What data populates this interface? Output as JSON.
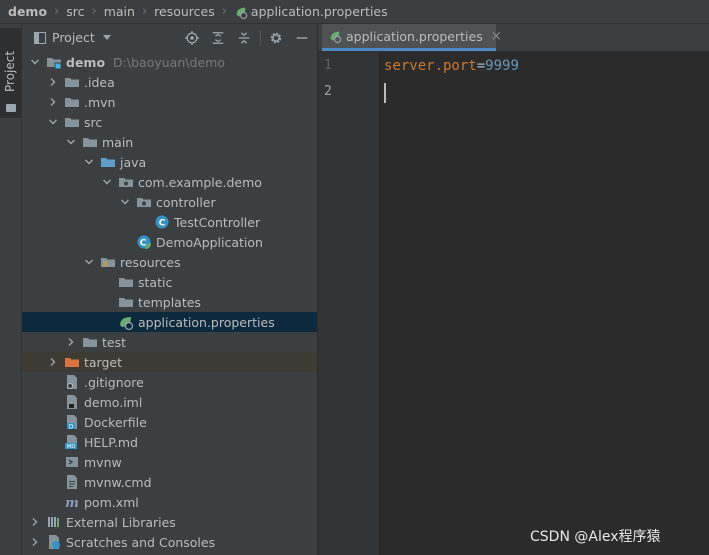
{
  "breadcrumb": [
    "demo",
    "src",
    "main",
    "resources",
    "application.properties"
  ],
  "sidebar_strip": {
    "project_tab": "Project"
  },
  "panel": {
    "title": "Project",
    "tree": [
      {
        "label": "demo",
        "path": "D:\\baoyuan\\demo",
        "icon": "module-folder-icon",
        "depth": 0,
        "arrow": "down",
        "bold": true
      },
      {
        "label": ".idea",
        "icon": "folder-icon",
        "depth": 1,
        "arrow": "right"
      },
      {
        "label": ".mvn",
        "icon": "folder-icon",
        "depth": 1,
        "arrow": "right"
      },
      {
        "label": "src",
        "icon": "folder-icon",
        "depth": 1,
        "arrow": "down"
      },
      {
        "label": "main",
        "icon": "folder-icon",
        "depth": 2,
        "arrow": "down"
      },
      {
        "label": "java",
        "icon": "source-folder-icon",
        "depth": 3,
        "arrow": "down"
      },
      {
        "label": "com.example.demo",
        "icon": "package-icon",
        "depth": 4,
        "arrow": "down"
      },
      {
        "label": "controller",
        "icon": "package-icon",
        "depth": 5,
        "arrow": "down"
      },
      {
        "label": "TestController",
        "icon": "class-icon",
        "depth": 6,
        "arrow": "none"
      },
      {
        "label": "DemoApplication",
        "icon": "spring-class-icon",
        "depth": 5,
        "arrow": "none"
      },
      {
        "label": "resources",
        "icon": "resources-folder-icon",
        "depth": 3,
        "arrow": "down"
      },
      {
        "label": "static",
        "icon": "folder-icon",
        "depth": 4,
        "arrow": "none"
      },
      {
        "label": "templates",
        "icon": "folder-icon",
        "depth": 4,
        "arrow": "none"
      },
      {
        "label": "application.properties",
        "icon": "spring-properties-icon",
        "depth": 4,
        "arrow": "none",
        "selected": true
      },
      {
        "label": "test",
        "icon": "folder-icon",
        "depth": 2,
        "arrow": "right"
      },
      {
        "label": "target",
        "icon": "excluded-folder-icon",
        "depth": 1,
        "arrow": "right",
        "excluded": true
      },
      {
        "label": ".gitignore",
        "icon": "gitignore-file-icon",
        "depth": 1,
        "arrow": "none"
      },
      {
        "label": "demo.iml",
        "icon": "iml-file-icon",
        "depth": 1,
        "arrow": "none"
      },
      {
        "label": "Dockerfile",
        "icon": "docker-file-icon",
        "depth": 1,
        "arrow": "none"
      },
      {
        "label": "HELP.md",
        "icon": "markdown-file-icon",
        "depth": 1,
        "arrow": "none"
      },
      {
        "label": "mvnw",
        "icon": "shell-file-icon",
        "depth": 1,
        "arrow": "none"
      },
      {
        "label": "mvnw.cmd",
        "icon": "text-file-icon",
        "depth": 1,
        "arrow": "none"
      },
      {
        "label": "pom.xml",
        "icon": "maven-file-icon",
        "depth": 1,
        "arrow": "none"
      },
      {
        "label": "External Libraries",
        "icon": "libraries-icon",
        "depth": 0,
        "arrow": "right"
      },
      {
        "label": "Scratches and Consoles",
        "icon": "scratches-icon",
        "depth": 0,
        "arrow": "right"
      }
    ]
  },
  "editor": {
    "tab_label": "application.properties",
    "tab_close": "×",
    "line_numbers": [
      "1",
      "2"
    ],
    "code_key": "server.port",
    "code_eq": "=",
    "code_value": "9999"
  },
  "watermark": "CSDN @Alex程序猿"
}
